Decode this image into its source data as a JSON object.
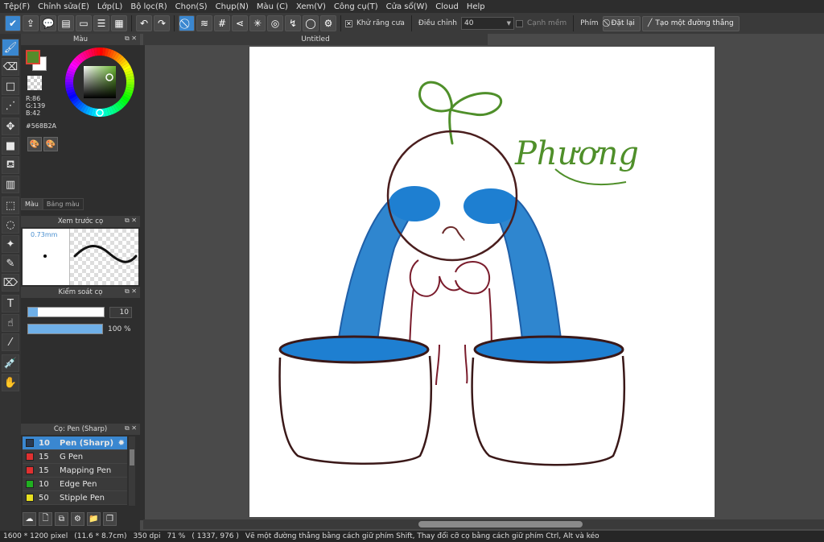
{
  "menubar": {
    "items": [
      "Tệp(F)",
      "Chỉnh sửa(E)",
      "Lớp(L)",
      "Bộ lọc(R)",
      "Chọn(S)",
      "Chụp(N)",
      "Màu (C)",
      "Xem(V)",
      "Công cụ(T)",
      "Cửa sổ(W)",
      "Cloud",
      "Help"
    ]
  },
  "toolbar": {
    "antialias_label": "Khử răng cưa",
    "adjust_label": "Điều chỉnh",
    "adjust_value": "40",
    "soft_edge_label": "Cạnh mềm",
    "key_label": "Phím",
    "reset_label": "Đặt lại",
    "make_line_label": "Tạo một đường thẳng"
  },
  "color_panel": {
    "title": "Màu",
    "fg_color": "#568B2A",
    "r": "R:86",
    "g": "G:139",
    "b": "B:42",
    "hex": "#568B2A",
    "tabs": [
      "Màu",
      "Bảng màu"
    ]
  },
  "preview_panel": {
    "title": "Xem trước cọ",
    "size": "0.73mm"
  },
  "control_panel": {
    "title": "Kiểm soát cọ",
    "size_value": "10",
    "size_fraction": 0.13,
    "opacity_value": "100 %",
    "opacity_fraction": 1.0
  },
  "brush_panel": {
    "title": "Cọ: Pen (Sharp)",
    "items": [
      {
        "size": "10",
        "name": "Pen (Sharp)",
        "color": "#2a3a52",
        "active": true
      },
      {
        "size": "15",
        "name": "G Pen",
        "color": "#e03030"
      },
      {
        "size": "15",
        "name": "Mapping Pen",
        "color": "#e03030"
      },
      {
        "size": "10",
        "name": "Edge Pen",
        "color": "#20b020"
      },
      {
        "size": "50",
        "name": "Stipple Pen",
        "color": "#e8e020"
      }
    ]
  },
  "document": {
    "tab_title": "Untitled",
    "drawing_text": "Phương"
  },
  "statusbar": {
    "dimensions": "1600 * 1200 pixel",
    "physical": "(11.6 * 8.7cm)",
    "dpi": "350 dpi",
    "zoom": "71 %",
    "cursor": "( 1337, 976 )",
    "hint": "Vẽ một đường thẳng bằng cách giữ phím Shift, Thay đổi cỡ cọ bằng cách giữ phím Ctrl, Alt và kéo"
  }
}
